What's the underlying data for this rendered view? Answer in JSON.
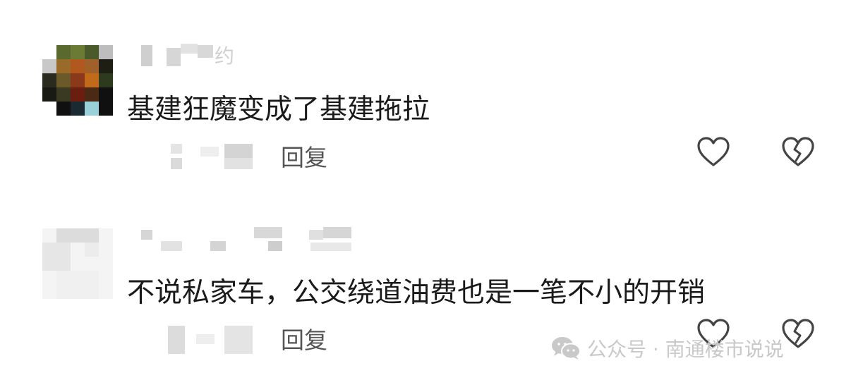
{
  "comments": [
    {
      "nickname_tail": "约",
      "text": "基建狂魔变成了基建拖拉",
      "reply_label": "回复",
      "like_icon": "heart-outline-icon",
      "dislike_icon": "broken-heart-outline-icon"
    },
    {
      "nickname_tail": "",
      "text": "不说私家车，公交绕道油费也是一笔不小的开销",
      "reply_label": "回复",
      "like_icon": "heart-outline-icon",
      "dislike_icon": "broken-heart-outline-icon"
    }
  ],
  "watermark": {
    "text": "公众号 · 南通楼市说说",
    "icon": "wechat-logo-icon",
    "color": "#c9c9c9"
  },
  "colors": {
    "text": "#1a1a1a",
    "reply": "#555555",
    "icon_stroke": "#444444",
    "avatar_1": [
      "#4a5a2a",
      "#8a6a2a",
      "#b0581e",
      "#2a2a1e",
      "#101010"
    ],
    "avatar_2": [
      "#dcdcdc",
      "#eeeeee",
      "#f6f6f6"
    ]
  }
}
